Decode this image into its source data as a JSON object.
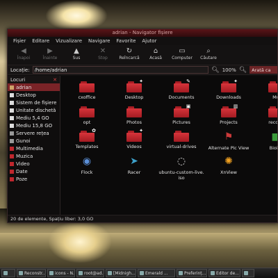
{
  "window": {
    "title": "adrian - Navigator fișiere"
  },
  "menu": [
    "Fișier",
    "Editare",
    "Vizualizare",
    "Navigare",
    "Favorite",
    "Ajutor"
  ],
  "toolbar": [
    {
      "label": "Înapoi",
      "icon": "back-arrow-icon",
      "disabled": true
    },
    {
      "label": "Înainte",
      "icon": "forward-arrow-icon",
      "disabled": true
    },
    {
      "label": "Sus",
      "icon": "up-arrow-icon",
      "disabled": false
    },
    {
      "label": "Stop",
      "icon": "stop-icon",
      "disabled": true
    },
    {
      "label": "Reîncarcă",
      "icon": "reload-icon",
      "disabled": false
    },
    {
      "label": "Acasă",
      "icon": "home-icon",
      "disabled": false
    },
    {
      "label": "Computer",
      "icon": "computer-icon",
      "disabled": false
    },
    {
      "label": "Căutare",
      "icon": "search-icon",
      "disabled": false
    }
  ],
  "location": {
    "label": "Locație:",
    "value": "/home/adrian",
    "zoom": "100%",
    "view_mode": "Arată ca"
  },
  "sidebar": {
    "title": "Locuri",
    "items": [
      {
        "label": "adrian",
        "icon": "home",
        "active": true
      },
      {
        "label": "Desktop",
        "icon": "drive",
        "active": false
      },
      {
        "label": "Sistem de fișiere",
        "icon": "drive",
        "active": false
      },
      {
        "label": "Unitate dischetă",
        "icon": "drive",
        "active": false
      },
      {
        "label": "Mediu 5,4 GO",
        "icon": "drive",
        "active": false
      },
      {
        "label": "Mediu 15,8 GO",
        "icon": "drive",
        "active": false
      },
      {
        "label": "Servere rețea",
        "icon": "net",
        "active": false
      },
      {
        "label": "Gunoi",
        "icon": "net",
        "active": false
      },
      {
        "label": "Multimedia",
        "icon": "folder",
        "active": false
      },
      {
        "label": "Muzica",
        "icon": "folder",
        "active": false
      },
      {
        "label": "Video",
        "icon": "folder",
        "active": false
      },
      {
        "label": "Date",
        "icon": "folder",
        "active": false
      },
      {
        "label": "Poze",
        "icon": "folder",
        "active": false
      }
    ]
  },
  "files": [
    {
      "name": "cxoffice",
      "type": "folder",
      "emblem": ""
    },
    {
      "name": "Desktop",
      "type": "folder",
      "emblem": "✦"
    },
    {
      "name": "Documents",
      "type": "folder",
      "emblem": "✎"
    },
    {
      "name": "Downloads",
      "type": "folder",
      "emblem": "✦"
    },
    {
      "name": "Mu",
      "type": "folder",
      "emblem": ""
    },
    {
      "name": "opt",
      "type": "folder",
      "emblem": ""
    },
    {
      "name": "Photos",
      "type": "folder",
      "emblem": ""
    },
    {
      "name": "Pictures",
      "type": "folder",
      "emblem": "▣"
    },
    {
      "name": "Projects",
      "type": "folder",
      "emblem": "▥"
    },
    {
      "name": "recons",
      "type": "folder",
      "emblem": ""
    },
    {
      "name": "Templates",
      "type": "folder",
      "emblem": "✿"
    },
    {
      "name": "Videos",
      "type": "folder",
      "emblem": "✦"
    },
    {
      "name": "virtual-drives",
      "type": "folder",
      "emblem": ""
    },
    {
      "name": "Alternate Pic View",
      "type": "app",
      "emblem": "⚑"
    },
    {
      "name": "Bioint",
      "type": "app",
      "emblem": ""
    },
    {
      "name": "Flock",
      "type": "app",
      "emblem": "◉"
    },
    {
      "name": "Racer",
      "type": "app",
      "emblem": "➤"
    },
    {
      "name": "ubuntu-custom-live.\niso",
      "type": "file",
      "emblem": "◌"
    },
    {
      "name": "XnView",
      "type": "app",
      "emblem": "✺"
    }
  ],
  "status": "20 de elemente, Spațiu liber: 3,0 GO",
  "taskbar": [
    {
      "label": "",
      "icon": "menu"
    },
    {
      "label": "Reconstr...",
      "icon": "browser"
    },
    {
      "label": "icons - N...",
      "icon": "folder"
    },
    {
      "label": "root@ad...",
      "icon": "terminal"
    },
    {
      "label": "[Midnigh...",
      "icon": "terminal"
    },
    {
      "label": "Emerald ...",
      "icon": "settings"
    },
    {
      "label": "Preferinț...",
      "icon": "settings"
    },
    {
      "label": "Editor de...",
      "icon": "editor"
    },
    {
      "label": "",
      "icon": "folder"
    }
  ],
  "colors": {
    "accent": "#7a2327",
    "folder": "#c0272d",
    "background": "#0b0a0a"
  }
}
